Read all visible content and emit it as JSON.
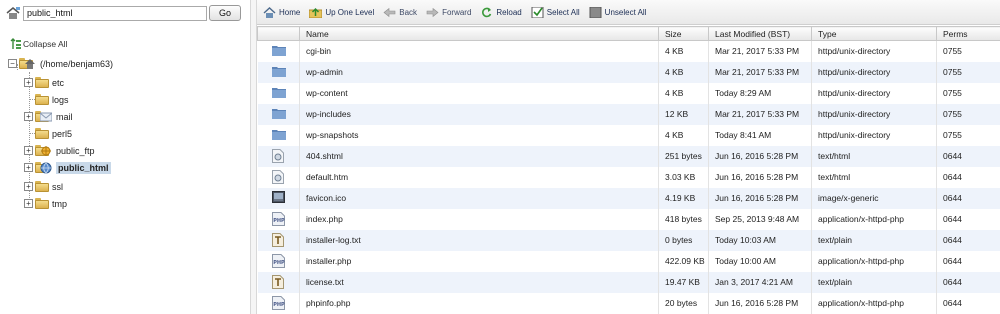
{
  "path_bar": {
    "value": "public_html",
    "go_label": "Go"
  },
  "tree": {
    "collapse_label": "Collapse All",
    "root_label": "(/home/benjam63)",
    "items": [
      {
        "label": "etc",
        "expandable": true
      },
      {
        "label": "logs",
        "expandable": false
      },
      {
        "label": "mail",
        "expandable": true
      },
      {
        "label": "perl5",
        "expandable": false
      },
      {
        "label": "public_ftp",
        "expandable": true
      },
      {
        "label": "public_html",
        "expandable": true,
        "selected": true
      },
      {
        "label": "ssl",
        "expandable": true
      },
      {
        "label": "tmp",
        "expandable": true
      }
    ]
  },
  "toolbar": {
    "home": "Home",
    "up": "Up One Level",
    "back": "Back",
    "forward": "Forward",
    "reload": "Reload",
    "select_all": "Select All",
    "unselect_all": "Unselect All"
  },
  "table": {
    "headers": {
      "name": "Name",
      "size": "Size",
      "modified": "Last Modified (BST)",
      "type": "Type",
      "perms": "Perms"
    },
    "rows": [
      {
        "icon": "folder-icon",
        "name": "cgi-bin",
        "size": "4 KB",
        "modified": "Mar 21, 2017 5:33 PM",
        "type": "httpd/unix-directory",
        "perms": "0755"
      },
      {
        "icon": "folder-icon",
        "name": "wp-admin",
        "size": "4 KB",
        "modified": "Mar 21, 2017 5:33 PM",
        "type": "httpd/unix-directory",
        "perms": "0755"
      },
      {
        "icon": "folder-icon",
        "name": "wp-content",
        "size": "4 KB",
        "modified": "Today 8:29 AM",
        "type": "httpd/unix-directory",
        "perms": "0755"
      },
      {
        "icon": "folder-icon",
        "name": "wp-includes",
        "size": "12 KB",
        "modified": "Mar 21, 2017 5:33 PM",
        "type": "httpd/unix-directory",
        "perms": "0755"
      },
      {
        "icon": "folder-icon",
        "name": "wp-snapshots",
        "size": "4 KB",
        "modified": "Today 8:41 AM",
        "type": "httpd/unix-directory",
        "perms": "0755"
      },
      {
        "icon": "html-file-icon",
        "name": "404.shtml",
        "size": "251 bytes",
        "modified": "Jun 16, 2016 5:28 PM",
        "type": "text/html",
        "perms": "0644"
      },
      {
        "icon": "html-file-icon",
        "name": "default.htm",
        "size": "3.03 KB",
        "modified": "Jun 16, 2016 5:28 PM",
        "type": "text/html",
        "perms": "0644"
      },
      {
        "icon": "image-file-icon",
        "name": "favicon.ico",
        "size": "4.19 KB",
        "modified": "Jun 16, 2016 5:28 PM",
        "type": "image/x-generic",
        "perms": "0644"
      },
      {
        "icon": "php-file-icon",
        "name": "index.php",
        "size": "418 bytes",
        "modified": "Sep 25, 2013 9:48 AM",
        "type": "application/x-httpd-php",
        "perms": "0644"
      },
      {
        "icon": "text-file-icon",
        "name": "installer-log.txt",
        "size": "0 bytes",
        "modified": "Today 10:03 AM",
        "type": "text/plain",
        "perms": "0644"
      },
      {
        "icon": "php-file-icon",
        "name": "installer.php",
        "size": "422.09 KB",
        "modified": "Today 10:00 AM",
        "type": "application/x-httpd-php",
        "perms": "0644"
      },
      {
        "icon": "text-file-icon",
        "name": "license.txt",
        "size": "19.47 KB",
        "modified": "Jan 3, 2017 4:21 AM",
        "type": "text/plain",
        "perms": "0644"
      },
      {
        "icon": "php-file-icon",
        "name": "phpinfo.php",
        "size": "20 bytes",
        "modified": "Jun 16, 2016 5:28 PM",
        "type": "application/x-httpd-php",
        "perms": "0644"
      }
    ]
  },
  "colors": {
    "row_alt": "#eef3fb",
    "selected_tree": "#c9d9e9",
    "link": "#1c2e55"
  }
}
